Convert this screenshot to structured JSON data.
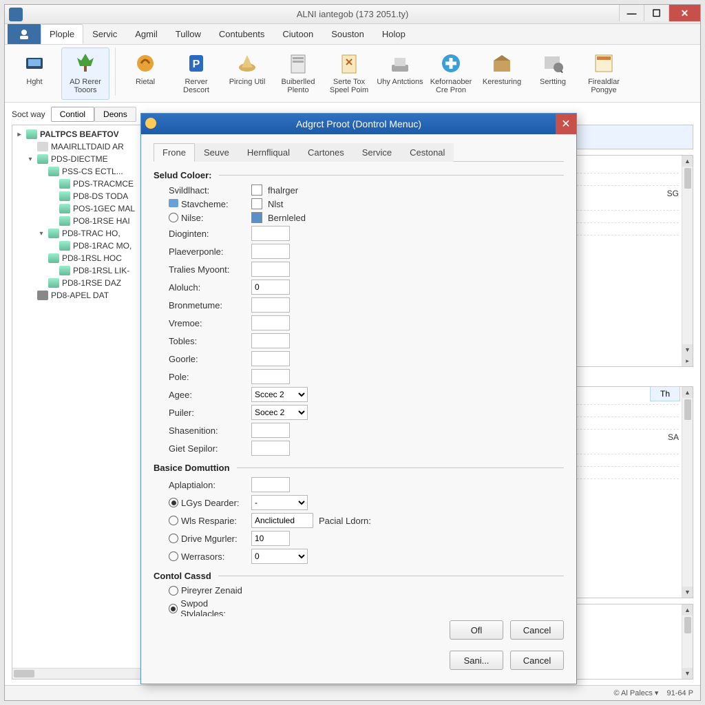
{
  "window": {
    "title": "ALNI iantegob (173 2051.ty)",
    "controls": {
      "min": "—",
      "max": "☐",
      "close": "✕"
    }
  },
  "menu": {
    "items": [
      "Plople",
      "Servic",
      "Agmil",
      "Tullow",
      "Contubents",
      "Ciutoon",
      "Souston",
      "Holop"
    ],
    "active_index": 0
  },
  "ribbon": {
    "items": [
      {
        "label": "Hght"
      },
      {
        "label": "AD Rerer Tooors",
        "sel": true
      },
      {
        "label": "Rietal"
      },
      {
        "label": "Rerver Descort"
      },
      {
        "label": "Pircing Util"
      },
      {
        "label": "Buiberlled Plento"
      },
      {
        "label": "Serte Tox Speel Poim"
      },
      {
        "label": "Uhy Antctions"
      },
      {
        "label": "Kefornaober Cre Pron"
      },
      {
        "label": "Keresturing"
      },
      {
        "label": "Sertting"
      },
      {
        "label": "Firealdlar Pongye"
      }
    ]
  },
  "left_tabs": {
    "sort_label": "Soct way",
    "items": [
      "Contiol",
      "Deons"
    ],
    "active": 0
  },
  "tree": [
    {
      "depth": 0,
      "twisty": "▸",
      "icon": "server",
      "text": "PALTPCS BEAFTOV",
      "root": true
    },
    {
      "depth": 1,
      "twisty": "",
      "icon": "group",
      "text": "MAAIRLLTDAID AR"
    },
    {
      "depth": 1,
      "twisty": "▾",
      "icon": "srv",
      "text": "PDS-DIECTME"
    },
    {
      "depth": 2,
      "twisty": "",
      "icon": "srv",
      "text": "PSS-CS ECTL..."
    },
    {
      "depth": 3,
      "twisty": "",
      "icon": "srv",
      "text": "PDS-TRACMCE"
    },
    {
      "depth": 3,
      "twisty": "",
      "icon": "srv",
      "text": "PD8-DS TODA"
    },
    {
      "depth": 3,
      "twisty": "",
      "icon": "srv",
      "text": "POS-1GEC MAL"
    },
    {
      "depth": 3,
      "twisty": "",
      "icon": "srv",
      "text": "PO8-1RSE HAI"
    },
    {
      "depth": 2,
      "twisty": "▾",
      "icon": "srv",
      "text": "PD8-TRAC HO,"
    },
    {
      "depth": 3,
      "twisty": "",
      "icon": "srv",
      "text": "PD8-1RAC MO,"
    },
    {
      "depth": 2,
      "twisty": "",
      "icon": "srv",
      "text": "PD8-1RSL HOC"
    },
    {
      "depth": 3,
      "twisty": "",
      "icon": "srv",
      "text": "PD8-1RSL LIK-"
    },
    {
      "depth": 2,
      "twisty": "",
      "icon": "srv",
      "text": "PD8-1RSE DAZ"
    },
    {
      "depth": 1,
      "twisty": "",
      "icon": "printer",
      "text": "PD8-APEL DAT"
    }
  ],
  "right": {
    "panel1_text": "SG",
    "panel2_tab": "Th",
    "panel2_text": "SA"
  },
  "status": {
    "left": "© Al Palecs ▾",
    "right": "91-64 P"
  },
  "dialog": {
    "title": "Adgrct Proot (Dontrol Menuc)",
    "close": "✕",
    "tabs": [
      "Frone",
      "Seuve",
      "Hernfliqual",
      "Cartones",
      "Service",
      "Cestonal"
    ],
    "active_tab": 0,
    "group1": {
      "title": "Selud Coloer:",
      "rows": [
        {
          "label": "Svildlhact:",
          "ctrl": "chk",
          "after": "fhalrger"
        },
        {
          "label": "Stavcheme:",
          "icon": true,
          "ctrl": "chk",
          "after": "Nlst"
        },
        {
          "label": "Nilse:",
          "radio": true,
          "ctrl": "chkfilled",
          "after": "Bernleled"
        },
        {
          "label": "Dioginten:",
          "ctrl": "txt",
          "val": ""
        },
        {
          "label": "Plaeverponle:",
          "ctrl": "txt",
          "val": ""
        },
        {
          "label": "Tralies Myoont:",
          "ctrl": "txt",
          "val": ""
        },
        {
          "label": "Aloluch:",
          "ctrl": "txt",
          "val": "0"
        },
        {
          "label": "Bronmetume:",
          "ctrl": "txt",
          "val": ""
        },
        {
          "label": "Vremoe:",
          "ctrl": "txt",
          "val": ""
        },
        {
          "label": "Tobles:",
          "ctrl": "txt",
          "val": ""
        },
        {
          "label": "Goorle:",
          "ctrl": "txt",
          "val": ""
        },
        {
          "label": "Pole:",
          "ctrl": "txt",
          "val": ""
        },
        {
          "label": "Agee:",
          "ctrl": "sel",
          "val": "Sccec 2"
        },
        {
          "label": "Puiler:",
          "ctrl": "sel",
          "val": "Socec 2"
        },
        {
          "label": "Shasenition:",
          "ctrl": "txt",
          "val": ""
        },
        {
          "label": "Giet Sepilor:",
          "ctrl": "txt",
          "val": ""
        }
      ]
    },
    "group2": {
      "title": "Basice Domuttion",
      "rows": [
        {
          "label": "Aplaptialon:",
          "ctrl": "txt",
          "val": ""
        },
        {
          "label": "LGys Dearder:",
          "radio": true,
          "checked": true,
          "ctrl": "sel",
          "val": "-"
        },
        {
          "label": "Wls Resparie:",
          "radio": true,
          "ctrl": "txtw",
          "val": "Anclictuled",
          "after": "Pacial Ldorn:"
        },
        {
          "label": "Drive Mgurler:",
          "radio": true,
          "ctrl": "txt",
          "val": "10"
        },
        {
          "label": "Werrasors:",
          "radio": true,
          "ctrl": "sel",
          "val": "0"
        }
      ]
    },
    "group3": {
      "title": "Contol Cassd",
      "rows": [
        {
          "label": "Pireyrer Zenaid",
          "radio": true
        },
        {
          "label": "Swpod Stylalacles:",
          "radio": true,
          "checked": true
        }
      ]
    },
    "buttons": {
      "ok": "Ofl",
      "cancel1": "Cancel",
      "sani": "Sani...",
      "cancel2": "Cancel"
    }
  }
}
